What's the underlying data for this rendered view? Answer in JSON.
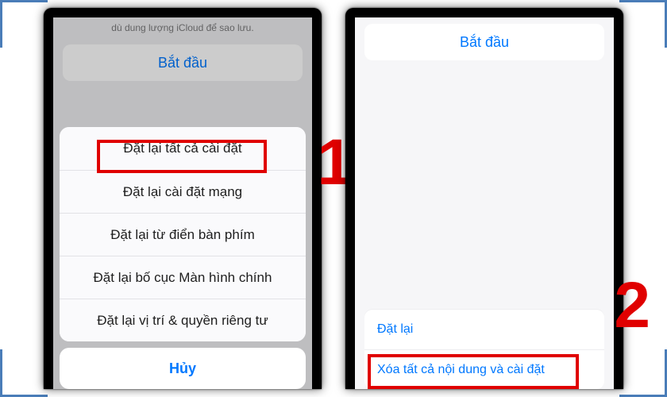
{
  "panel1": {
    "top_text": "dù dung lượng iCloud để sao lưu.",
    "start_button": "Bắt đầu",
    "sheet_items": [
      "Đặt lại tất cả cài đặt",
      "Đặt lại cài đặt mạng",
      "Đặt lại từ điển bàn phím",
      "Đặt lại bố cục Màn hình chính",
      "Đặt lại vị trí & quyền riêng tư"
    ],
    "cancel": "Hủy",
    "annotation": "1"
  },
  "panel2": {
    "start_button": "Bắt đầu",
    "rows": [
      "Đặt lại",
      "Xóa tất cả nội dung và cài đặt"
    ],
    "annotation": "2"
  }
}
